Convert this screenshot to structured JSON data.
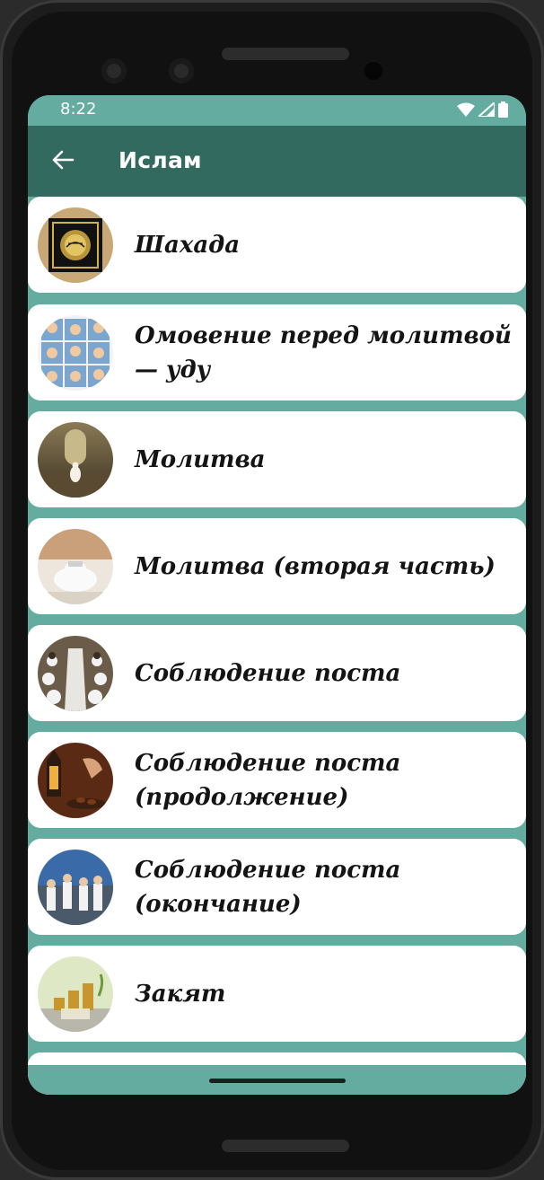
{
  "status_bar": {
    "time": "8:22",
    "icons": [
      "wifi-icon",
      "signal-icon",
      "battery-icon"
    ]
  },
  "app_bar": {
    "title": "Ислам",
    "back_icon": "arrow-left-icon"
  },
  "colors": {
    "primary_dark": "#336a60",
    "primary": "#64aba0",
    "card": "#ffffff",
    "text": "#141414"
  },
  "items": [
    {
      "label": "Шахада",
      "image": "shahada-calligraphy"
    },
    {
      "label": "Омовение перед молитвой — уду",
      "image": "wudu-steps-grid"
    },
    {
      "label": "Молитва",
      "image": "prayer-in-mosque"
    },
    {
      "label": "Молитва (вторая часть)",
      "image": "prostration"
    },
    {
      "label": "Соблюдение поста",
      "image": "iftar-table"
    },
    {
      "label": "Соблюдение поста (продолжение)",
      "image": "lantern-and-dates"
    },
    {
      "label": "Соблюдение поста (окончание)",
      "image": "eid-gathering"
    },
    {
      "label": "Закят",
      "image": "zakat-coins"
    }
  ]
}
